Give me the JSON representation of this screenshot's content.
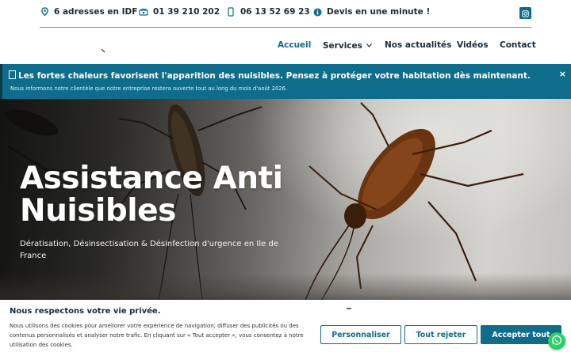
{
  "topbar": {
    "address": "6 adresses en IDF",
    "phone": "01 39 210 202",
    "mobile": "06 13 52 69 23",
    "quote": "Devis en une minute !"
  },
  "nav": {
    "items": [
      {
        "label": "Accueil",
        "active": true
      },
      {
        "label": "Services",
        "has_dropdown": true
      },
      {
        "label": "Nos actualités"
      },
      {
        "label": "Vidéos"
      },
      {
        "label": "Contact"
      }
    ]
  },
  "alert": {
    "title": "Les fortes chaleurs favorisent l'apparition des nuisibles. Pensez à protéger votre habitation dès maintenant.",
    "subtitle": "Nous informons notre clientèle que notre entreprise restera ouverte tout au long du mois d'août 2026.",
    "close": "×"
  },
  "hero": {
    "title": "Assistance Anti Nuisibles",
    "subtitle": "Dératisation, Désinsectisation & Désinfection d'urgence en Ile de France"
  },
  "cookie": {
    "title": "Nous respectons votre vie privée.",
    "text": "Nous utilisons des cookies pour améliorer votre expérience de navigation, diffuser des publicités ou des contenus personnalisés et analyser notre trafic. En cliquant sur « Tout accepter », vous consentez à notre utilisation des cookies.",
    "customize": "Personnaliser",
    "reject": "Tout rejeter",
    "accept": "Accepter tout"
  },
  "icons": {
    "address": "location-icon",
    "phone": "phone-icon",
    "mobile": "mobile-icon",
    "quote": "info-icon",
    "social": "instagram-icon",
    "chat": "whatsapp-icon"
  },
  "colors": {
    "brand": "#0e6d8a",
    "text": "#1b2b3a",
    "whatsapp": "#25d366"
  }
}
